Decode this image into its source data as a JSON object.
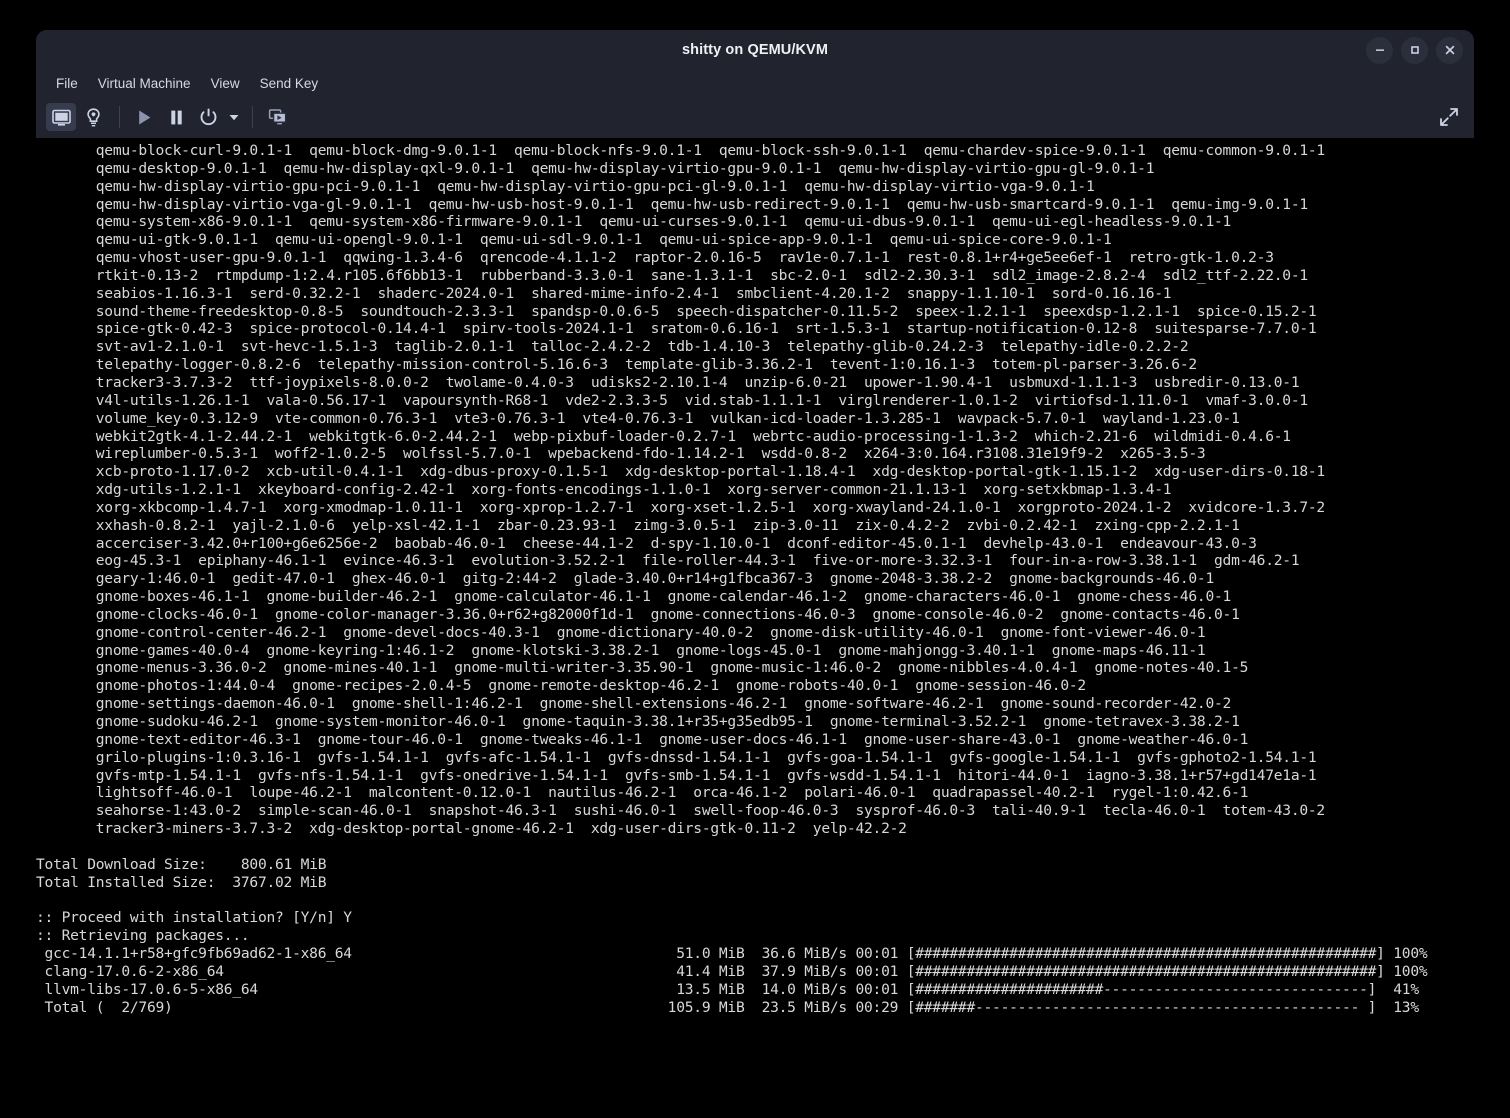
{
  "window": {
    "title": "shitty on QEMU/KVM",
    "controls": [
      {
        "name": "minimize-button",
        "glyph": "minimize"
      },
      {
        "name": "maximize-button",
        "glyph": "maximize"
      },
      {
        "name": "close-button",
        "glyph": "close"
      }
    ],
    "colors": {
      "chrome_bg": "#21242f",
      "chrome_text": "#d6d9e3",
      "title_text": "#f0f1f5",
      "console_bg": "#000000",
      "console_fg": "#d8d8d8",
      "toolbar_active_bg": "#363b4d"
    }
  },
  "menubar": {
    "items": [
      {
        "label": "File"
      },
      {
        "label": "Virtual Machine"
      },
      {
        "label": "View"
      },
      {
        "label": "Send Key"
      }
    ]
  },
  "toolbar": {
    "buttons": [
      {
        "name": "show-console-button",
        "icon": "monitor-icon",
        "active": true
      },
      {
        "name": "show-details-button",
        "icon": "lightbulb-icon",
        "active": false
      },
      {
        "name": "run-button",
        "icon": "play-icon",
        "active": false
      },
      {
        "name": "pause-button",
        "icon": "pause-icon",
        "active": false
      },
      {
        "name": "shutdown-button",
        "icon": "power-icon",
        "active": false
      },
      {
        "name": "shutdown-options-button",
        "icon": "chevron-down-icon",
        "active": false
      },
      {
        "name": "take-snapshot-button",
        "icon": "screens-icon",
        "active": false
      }
    ],
    "fullscreen": {
      "name": "fullscreen-button",
      "icon": "expand-arrows-icon"
    }
  },
  "console": {
    "lines": [
      "       qemu-block-curl-9.0.1-1  qemu-block-dmg-9.0.1-1  qemu-block-nfs-9.0.1-1  qemu-block-ssh-9.0.1-1  qemu-chardev-spice-9.0.1-1  qemu-common-9.0.1-1",
      "       qemu-desktop-9.0.1-1  qemu-hw-display-qxl-9.0.1-1  qemu-hw-display-virtio-gpu-9.0.1-1  qemu-hw-display-virtio-gpu-gl-9.0.1-1",
      "       qemu-hw-display-virtio-gpu-pci-9.0.1-1  qemu-hw-display-virtio-gpu-pci-gl-9.0.1-1  qemu-hw-display-virtio-vga-9.0.1-1",
      "       qemu-hw-display-virtio-vga-gl-9.0.1-1  qemu-hw-usb-host-9.0.1-1  qemu-hw-usb-redirect-9.0.1-1  qemu-hw-usb-smartcard-9.0.1-1  qemu-img-9.0.1-1",
      "       qemu-system-x86-9.0.1-1  qemu-system-x86-firmware-9.0.1-1  qemu-ui-curses-9.0.1-1  qemu-ui-dbus-9.0.1-1  qemu-ui-egl-headless-9.0.1-1",
      "       qemu-ui-gtk-9.0.1-1  qemu-ui-opengl-9.0.1-1  qemu-ui-sdl-9.0.1-1  qemu-ui-spice-app-9.0.1-1  qemu-ui-spice-core-9.0.1-1",
      "       qemu-vhost-user-gpu-9.0.1-1  qqwing-1.3.4-6  qrencode-4.1.1-2  raptor-2.0.16-5  rav1e-0.7.1-1  rest-0.8.1+r4+ge5ee6ef-1  retro-gtk-1.0.2-3",
      "       rtkit-0.13-2  rtmpdump-1:2.4.r105.6f6bb13-1  rubberband-3.3.0-1  sane-1.3.1-1  sbc-2.0-1  sdl2-2.30.3-1  sdl2_image-2.8.2-4  sdl2_ttf-2.22.0-1",
      "       seabios-1.16.3-1  serd-0.32.2-1  shaderc-2024.0-1  shared-mime-info-2.4-1  smbclient-4.20.1-2  snappy-1.1.10-1  sord-0.16.16-1",
      "       sound-theme-freedesktop-0.8-5  soundtouch-2.3.3-1  spandsp-0.0.6-5  speech-dispatcher-0.11.5-2  speex-1.2.1-1  speexdsp-1.2.1-1  spice-0.15.2-1",
      "       spice-gtk-0.42-3  spice-protocol-0.14.4-1  spirv-tools-2024.1-1  sratom-0.6.16-1  srt-1.5.3-1  startup-notification-0.12-8  suitesparse-7.7.0-1",
      "       svt-av1-2.1.0-1  svt-hevc-1.5.1-3  taglib-2.0.1-1  talloc-2.4.2-2  tdb-1.4.10-3  telepathy-glib-0.24.2-3  telepathy-idle-0.2.2-2",
      "       telepathy-logger-0.8.2-6  telepathy-mission-control-5.16.6-3  template-glib-3.36.2-1  tevent-1:0.16.1-3  totem-pl-parser-3.26.6-2",
      "       tracker3-3.7.3-2  ttf-joypixels-8.0.0-2  twolame-0.4.0-3  udisks2-2.10.1-4  unzip-6.0-21  upower-1.90.4-1  usbmuxd-1.1.1-3  usbredir-0.13.0-1",
      "       v4l-utils-1.26.1-1  vala-0.56.17-1  vapoursynth-R68-1  vde2-2.3.3-5  vid.stab-1.1.1-1  virglrenderer-1.0.1-2  virtiofsd-1.11.0-1  vmaf-3.0.0-1",
      "       volume_key-0.3.12-9  vte-common-0.76.3-1  vte3-0.76.3-1  vte4-0.76.3-1  vulkan-icd-loader-1.3.285-1  wavpack-5.7.0-1  wayland-1.23.0-1",
      "       webkit2gtk-4.1-2.44.2-1  webkitgtk-6.0-2.44.2-1  webp-pixbuf-loader-0.2.7-1  webrtc-audio-processing-1-1.3-2  which-2.21-6  wildmidi-0.4.6-1",
      "       wireplumber-0.5.3-1  woff2-1.0.2-5  wolfssl-5.7.0-1  wpebackend-fdo-1.14.2-1  wsdd-0.8-2  x264-3:0.164.r3108.31e19f9-2  x265-3.5-3",
      "       xcb-proto-1.17.0-2  xcb-util-0.4.1-1  xdg-dbus-proxy-0.1.5-1  xdg-desktop-portal-1.18.4-1  xdg-desktop-portal-gtk-1.15.1-2  xdg-user-dirs-0.18-1",
      "       xdg-utils-1.2.1-1  xkeyboard-config-2.42-1  xorg-fonts-encodings-1.1.0-1  xorg-server-common-21.1.13-1  xorg-setxkbmap-1.3.4-1",
      "       xorg-xkbcomp-1.4.7-1  xorg-xmodmap-1.0.11-1  xorg-xprop-1.2.7-1  xorg-xset-1.2.5-1  xorg-xwayland-24.1.0-1  xorgproto-2024.1-2  xvidcore-1.3.7-2",
      "       xxhash-0.8.2-1  yajl-2.1.0-6  yelp-xsl-42.1-1  zbar-0.23.93-1  zimg-3.0.5-1  zip-3.0-11  zix-0.4.2-2  zvbi-0.2.42-1  zxing-cpp-2.2.1-1",
      "       accerciser-3.42.0+r100+g6e6256e-2  baobab-46.0-1  cheese-44.1-2  d-spy-1.10.0-1  dconf-editor-45.0.1-1  devhelp-43.0-1  endeavour-43.0-3",
      "       eog-45.3-1  epiphany-46.1-1  evince-46.3-1  evolution-3.52.2-1  file-roller-44.3-1  five-or-more-3.32.3-1  four-in-a-row-3.38.1-1  gdm-46.2-1",
      "       geary-1:46.0-1  gedit-47.0-1  ghex-46.0-1  gitg-2:44-2  glade-3.40.0+r14+g1fbca367-3  gnome-2048-3.38.2-2  gnome-backgrounds-46.0-1",
      "       gnome-boxes-46.1-1  gnome-builder-46.2-1  gnome-calculator-46.1-1  gnome-calendar-46.1-2  gnome-characters-46.0-1  gnome-chess-46.0-1",
      "       gnome-clocks-46.0-1  gnome-color-manager-3.36.0+r62+g82000f1d-1  gnome-connections-46.0-3  gnome-console-46.0-2  gnome-contacts-46.0-1",
      "       gnome-control-center-46.2-1  gnome-devel-docs-40.3-1  gnome-dictionary-40.0-2  gnome-disk-utility-46.0-1  gnome-font-viewer-46.0-1",
      "       gnome-games-40.0-4  gnome-keyring-1:46.1-2  gnome-klotski-3.38.2-1  gnome-logs-45.0-1  gnome-mahjongg-3.40.1-1  gnome-maps-46.11-1",
      "       gnome-menus-3.36.0-2  gnome-mines-40.1-1  gnome-multi-writer-3.35.90-1  gnome-music-1:46.0-2  gnome-nibbles-4.0.4-1  gnome-notes-40.1-5",
      "       gnome-photos-1:44.0-4  gnome-recipes-2.0.4-5  gnome-remote-desktop-46.2-1  gnome-robots-40.0-1  gnome-session-46.0-2",
      "       gnome-settings-daemon-46.0-1  gnome-shell-1:46.2-1  gnome-shell-extensions-46.2-1  gnome-software-46.2-1  gnome-sound-recorder-42.0-2",
      "       gnome-sudoku-46.2-1  gnome-system-monitor-46.0-1  gnome-taquin-3.38.1+r35+g35edb95-1  gnome-terminal-3.52.2-1  gnome-tetravex-3.38.2-1",
      "       gnome-text-editor-46.3-1  gnome-tour-46.0-1  gnome-tweaks-46.1-1  gnome-user-docs-46.1-1  gnome-user-share-43.0-1  gnome-weather-46.0-1",
      "       grilo-plugins-1:0.3.16-1  gvfs-1.54.1-1  gvfs-afc-1.54.1-1  gvfs-dnssd-1.54.1-1  gvfs-goa-1.54.1-1  gvfs-google-1.54.1-1  gvfs-gphoto2-1.54.1-1",
      "       gvfs-mtp-1.54.1-1  gvfs-nfs-1.54.1-1  gvfs-onedrive-1.54.1-1  gvfs-smb-1.54.1-1  gvfs-wsdd-1.54.1-1  hitori-44.0-1  iagno-3.38.1+r57+gd147e1a-1",
      "       lightsoff-46.0-1  loupe-46.2-1  malcontent-0.12.0-1  nautilus-46.2-1  orca-46.1-2  polari-46.0-1  quadrapassel-40.2-1  rygel-1:0.42.6-1",
      "       seahorse-1:43.0-2  simple-scan-46.0-1  snapshot-46.3-1  sushi-46.0-1  swell-foop-46.0-3  sysprof-46.0-3  tali-40.9-1  tecla-46.0-1  totem-43.0-2",
      "       tracker3-miners-3.7.3-2  xdg-desktop-portal-gnome-46.2-1  xdg-user-dirs-gtk-0.11-2  yelp-42.2-2",
      "",
      "Total Download Size:    800.61 MiB",
      "Total Installed Size:  3767.02 MiB",
      "",
      ":: Proceed with installation? [Y/n] Y",
      ":: Retrieving packages...",
      " gcc-14.1.1+r58+gfc9fb69ad62-1-x86_64                                      51.0 MiB  36.6 MiB/s 00:01 [######################################################] 100%",
      " clang-17.0.6-2-x86_64                                                     41.4 MiB  37.9 MiB/s 00:01 [######################################################] 100%",
      " llvm-libs-17.0.6-5-x86_64                                                 13.5 MiB  14.0 MiB/s 00:01 [######################-------------------------------]  41%",
      " Total (  2/769)                                                          105.9 MiB  23.5 MiB/s 00:29 [#######--------------------------------------------- ]  13%"
    ],
    "summary": {
      "total_download_size_label": "Total Download Size:",
      "total_download_size_value": "800.61 MiB",
      "total_installed_size_label": "Total Installed Size:",
      "total_installed_size_value": "3767.02 MiB",
      "prompt": ":: Proceed with installation? [Y/n] Y",
      "prompt_answer": "Y",
      "retrieving": ":: Retrieving packages..."
    },
    "downloads": [
      {
        "package": "gcc-14.1.1+r58+gfc9fb69ad62-1-x86_64",
        "size": "51.0 MiB",
        "speed": "36.6 MiB/s",
        "eta": "00:01",
        "percent": "100%"
      },
      {
        "package": "clang-17.0.6-2-x86_64",
        "size": "41.4 MiB",
        "speed": "37.9 MiB/s",
        "eta": "00:01",
        "percent": "100%"
      },
      {
        "package": "llvm-libs-17.0.6-5-x86_64",
        "size": "13.5 MiB",
        "speed": "14.0 MiB/s",
        "eta": "00:01",
        "percent": "41%"
      },
      {
        "package": "Total (  2/769)",
        "size": "105.9 MiB",
        "speed": "23.5 MiB/s",
        "eta": "00:29",
        "percent": "13%"
      }
    ]
  }
}
